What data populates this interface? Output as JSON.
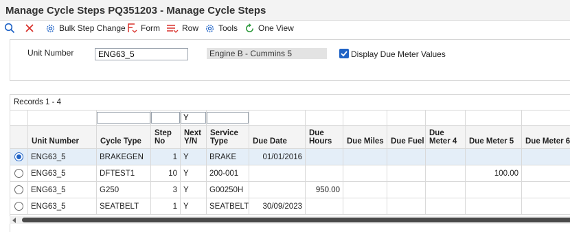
{
  "window": {
    "title": "Manage Cycle Steps PQ351203 - Manage Cycle Steps"
  },
  "toolbar": {
    "bulk_step_change": "Bulk Step Change",
    "form": "Form",
    "row": "Row",
    "tools": "Tools",
    "one_view": "One View"
  },
  "header": {
    "unit_number_label": "Unit Number",
    "unit_number_value": "ENG63_5",
    "unit_description": "Engine B - Cummins 5",
    "display_due_meter_label": "Display Due Meter Values",
    "display_due_meter_checked": true
  },
  "grid": {
    "records_label": "Records 1 - 4",
    "qbe": {
      "cycle_type": "",
      "step_no": "",
      "next_yn": "Y",
      "service_type": ""
    },
    "columns": [
      "Unit Number",
      "Cycle Type",
      "Step No",
      "Next Y/N",
      "Service Type",
      "Due Date",
      "Due Hours",
      "Due Miles",
      "Due Fuel",
      "Due Meter 4",
      "Due Meter 5",
      "Due Meter 6"
    ],
    "rows": [
      {
        "selected": true,
        "unit": "ENG63_5",
        "cycle": "BRAKEGEN",
        "step": "1",
        "next": "Y",
        "service": "BRAKE",
        "due_date": "01/01/2016",
        "due_hours": "",
        "due_miles": "",
        "due_fuel": "",
        "meter4": "",
        "meter5": "",
        "meter6": ""
      },
      {
        "selected": false,
        "unit": "ENG63_5",
        "cycle": "DFTEST1",
        "step": "10",
        "next": "Y",
        "service": "200-001",
        "due_date": "",
        "due_hours": "",
        "due_miles": "",
        "due_fuel": "",
        "meter4": "",
        "meter5": "100.00",
        "meter6": ""
      },
      {
        "selected": false,
        "unit": "ENG63_5",
        "cycle": "G250",
        "step": "3",
        "next": "Y",
        "service": "G00250H",
        "due_date": "",
        "due_hours": "950.00",
        "due_miles": "",
        "due_fuel": "",
        "meter4": "",
        "meter5": "",
        "meter6": ""
      },
      {
        "selected": false,
        "unit": "ENG63_5",
        "cycle": "SEATBELT",
        "step": "1",
        "next": "Y",
        "service": "SEATBELT",
        "due_date": "30/09/2023",
        "due_hours": "",
        "due_miles": "",
        "due_fuel": "",
        "meter4": "",
        "meter5": "",
        "meter6": ""
      }
    ]
  },
  "colors": {
    "accent": "#1f63c6",
    "close_red": "#d9302a",
    "selected_row": "#e4eef8"
  }
}
